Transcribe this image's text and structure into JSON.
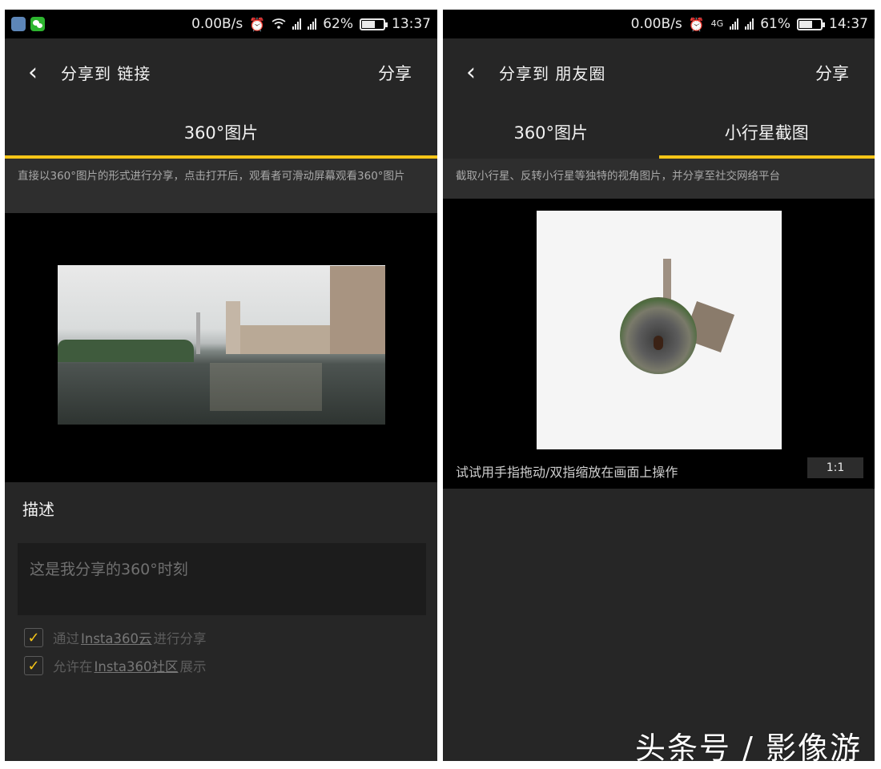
{
  "left": {
    "status": {
      "speed": "0.00B/s",
      "battery": "62%",
      "battery_level": 0.62,
      "time": "13:37"
    },
    "title": "分享到 链接",
    "share_label": "分享",
    "tabs": [
      {
        "label": "360°图片"
      }
    ],
    "description": "直接以360°图片的形式进行分享，点击打开后，观看者可滑动屏幕观看360°图片",
    "desc_label": "描述",
    "input_placeholder": "这是我分享的360°时刻",
    "options": [
      {
        "prefix": "通过",
        "link": "Insta360云",
        "suffix": "进行分享",
        "checked": true
      },
      {
        "prefix": "允许在",
        "link": "Insta360社区",
        "suffix": "展示",
        "checked": true
      }
    ]
  },
  "right": {
    "status": {
      "speed": "0.00B/s",
      "battery": "61%",
      "battery_level": 0.61,
      "time": "14:37",
      "network": "4G"
    },
    "title": "分享到 朋友圈",
    "share_label": "分享",
    "tabs": [
      {
        "label": "360°图片",
        "active": false
      },
      {
        "label": "小行星截图",
        "active": true
      }
    ],
    "description": "截取小行星、反转小行星等独特的视角图片，并分享至社交网络平台",
    "hint": "试试用手指拖动/双指缩放在画面上操作",
    "ratio_label": "1:1"
  },
  "watermark": "头条号 / 影像游",
  "colors": {
    "accent": "#f5c518",
    "background": "#262626",
    "statusbar": "#000000"
  },
  "icons": [
    "back-arrow-icon",
    "alarm-icon",
    "wifi-icon",
    "signal-icon",
    "battery-icon",
    "checkbox-checked-icon"
  ]
}
